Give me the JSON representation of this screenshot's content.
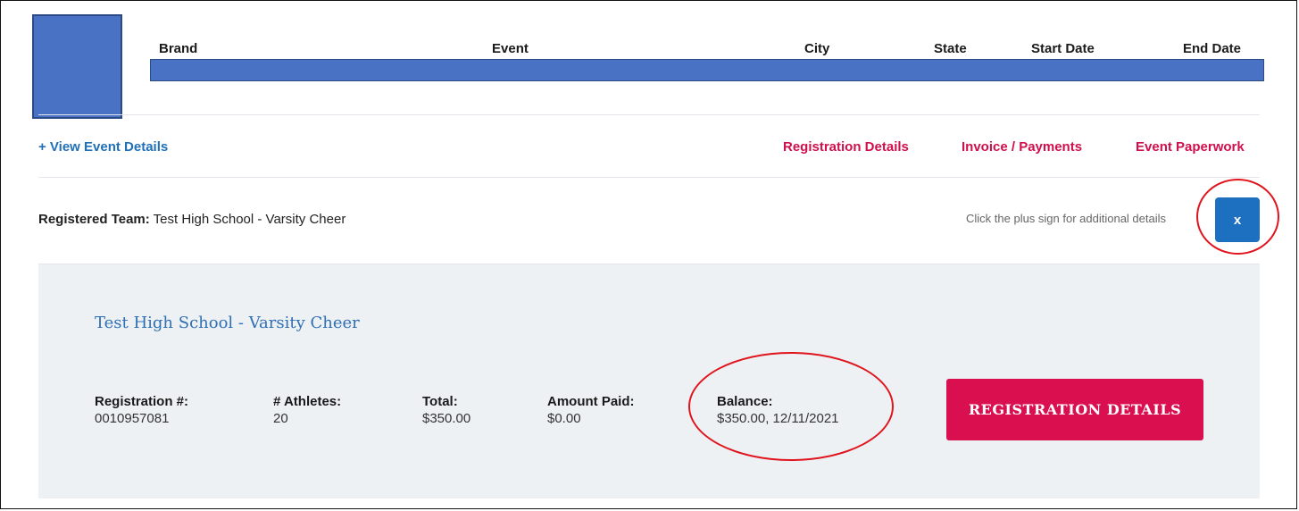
{
  "event_header": {
    "columns": [
      "Brand",
      "Event",
      "City",
      "State",
      "Start Date",
      "End Date"
    ]
  },
  "nav": {
    "view_details": "+ View Event Details",
    "registration_details": "Registration Details",
    "invoice_payments": "Invoice / Payments",
    "event_paperwork": "Event Paperwork"
  },
  "team_row": {
    "label": "Registered Team:",
    "team_name": "Test High School - Varsity Cheer",
    "hint": "Click the plus sign for additional details",
    "toggle_label": "x"
  },
  "detail_panel": {
    "title": "Test High School - Varsity Cheer",
    "stats": [
      {
        "label": "Registration #:",
        "value": "0010957081"
      },
      {
        "label": "# Athletes:",
        "value": "20"
      },
      {
        "label": "Total:",
        "value": "$350.00"
      },
      {
        "label": "Amount Paid:",
        "value": "$0.00"
      },
      {
        "label": "Balance:",
        "value": "$350.00, 12/11/2021"
      }
    ],
    "button_label": "REGISTRATION DETAILS"
  },
  "colors": {
    "header_bar": "#4a72c4",
    "link_blue": "#1f70b8",
    "accent_red": "#d0104c",
    "annotation_ring": "#e0141c",
    "panel_bg": "#edf1f4"
  }
}
